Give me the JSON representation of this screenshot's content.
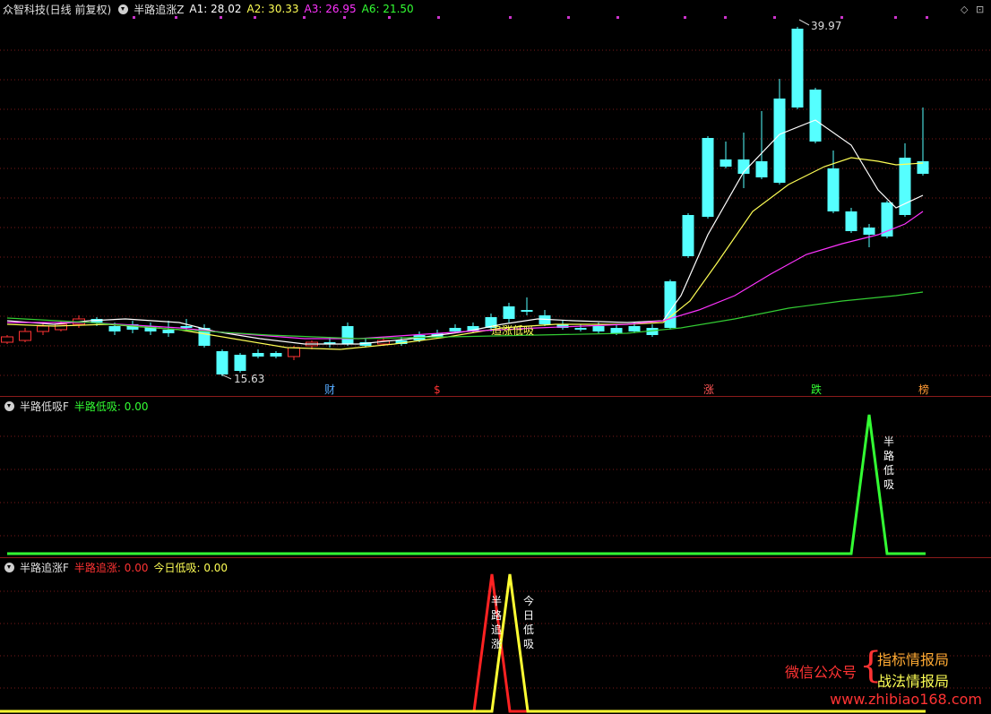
{
  "main": {
    "stock_title": "众智科技(日线 前复权)",
    "indicator_name": "半路追涨Z",
    "fields": [
      {
        "label": "A1: 28.02",
        "color": "#ffffff"
      },
      {
        "label": "A2: 30.33",
        "color": "#ffff55"
      },
      {
        "label": "A3: 26.95",
        "color": "#ff33ff"
      },
      {
        "label": "A6: 21.50",
        "color": "#33ff33"
      }
    ],
    "high_label": "39.97",
    "low_label": "15.63",
    "pattern_label": "追涨低吸",
    "event_markers": [
      {
        "label": "财",
        "color": "#55aaff"
      },
      {
        "label": "$",
        "color": "#ff3333"
      },
      {
        "label": "涨",
        "color": "#ff5555"
      },
      {
        "label": "跌",
        "color": "#33ff33"
      },
      {
        "label": "榜",
        "color": "#ff9933"
      }
    ]
  },
  "pane2": {
    "indicator_name": "半路低吸F",
    "value_label": "半路低吸: 0.00",
    "value_color": "#33ff33",
    "signal_text": "半路低吸"
  },
  "pane3": {
    "indicator_name": "半路追涨F",
    "value1_label": "半路追涨: 0.00",
    "value1_color": "#ff3333",
    "value2_label": "今日低吸: 0.00",
    "value2_color": "#ffff55",
    "signal1_text": "半路追涨",
    "signal2_text": "今日低吸"
  },
  "watermark": {
    "wechat": "微信公众号",
    "name1": "指标情报局",
    "name2": "战法情报局",
    "url": "www.zhibiao168.com"
  },
  "colors": {
    "up": "#ff3333",
    "down": "#55ffff",
    "ma1": "#ffffff",
    "ma2": "#ffff55",
    "ma3": "#ff33ff",
    "ma4": "#33cc33",
    "grid": "#8b1b1b"
  }
}
